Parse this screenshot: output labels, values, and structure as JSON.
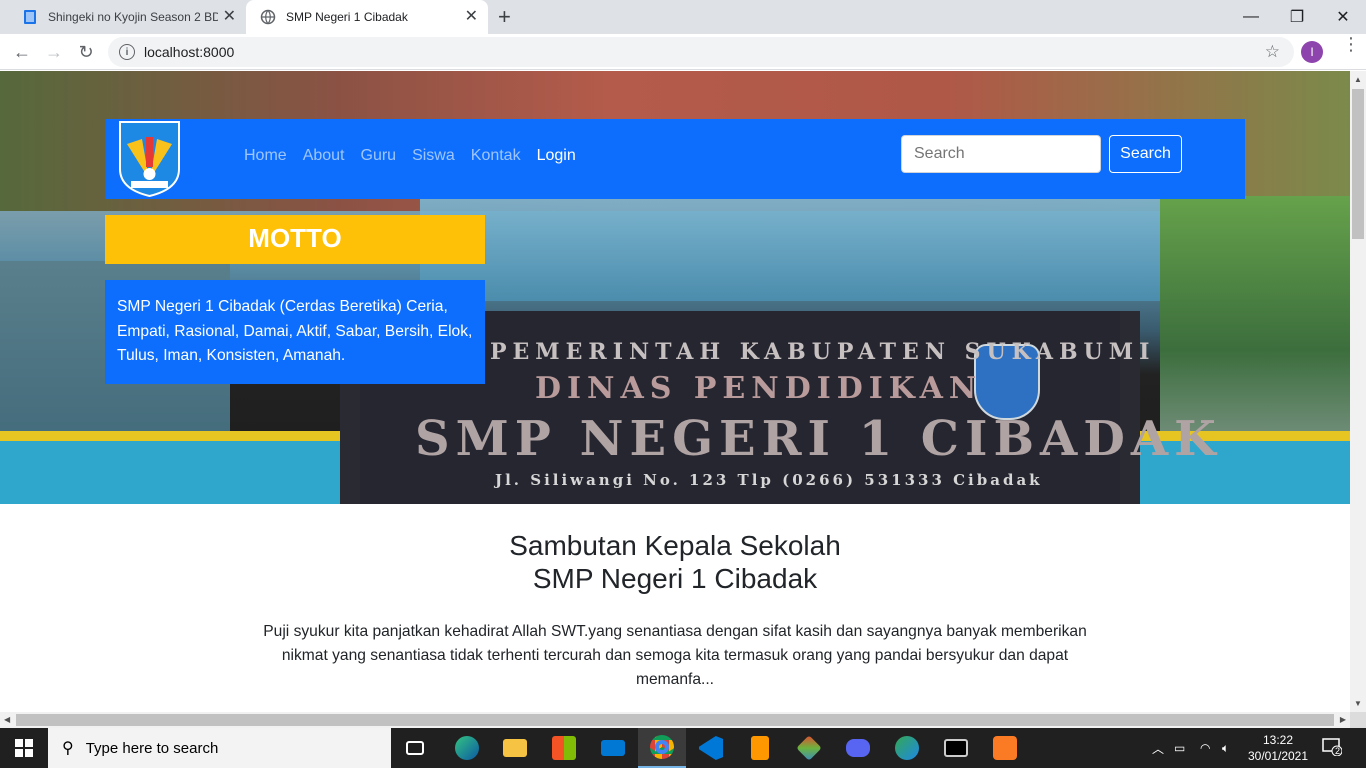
{
  "browser": {
    "tabs": [
      {
        "title": "Shingeki no Kyojin Season 2 BD (",
        "active": false
      },
      {
        "title": "SMP Negeri 1 Cibadak",
        "active": true
      }
    ],
    "url": "localhost:8000",
    "profile_initial": "I"
  },
  "hero": {
    "sign_line1": "PEMERINTAH KABUPATEN SUKABUMI",
    "sign_line2": "DINAS PENDIDIKAN",
    "sign_line3": "SMP NEGERI 1 CIBADAK",
    "sign_line4": "Jl. Siliwangi No. 123 Tlp (0266) 531333 Cibadak"
  },
  "navbar": {
    "links": [
      {
        "label": "Home",
        "active": false
      },
      {
        "label": "About",
        "active": false
      },
      {
        "label": "Guru",
        "active": false
      },
      {
        "label": "Siswa",
        "active": false
      },
      {
        "label": "Kontak",
        "active": false
      },
      {
        "label": "Login",
        "active": true
      }
    ],
    "search_placeholder": "Search",
    "search_button": "Search"
  },
  "motto": {
    "title": "MOTTO",
    "text": "SMP Negeri 1 Cibadak (Cerdas Beretika) Ceria, Empati, Rasional, Damai, Aktif, Sabar, Bersih, Elok, Tulus, Iman, Konsisten, Amanah."
  },
  "welcome": {
    "title_line1": "Sambutan Kepala Sekolah",
    "title_line2": "SMP Negeri 1 Cibadak",
    "text": "Puji syukur kita panjatkan kehadirat Allah SWT.yang senantiasa dengan sifat kasih dan sayangnya banyak memberikan nikmat yang senantiasa tidak terhenti tercurah dan semoga kita termasuk orang yang pandai bersyukur dan dapat memanfa..."
  },
  "taskbar": {
    "search_placeholder": "Type here to search",
    "time": "13:22",
    "date": "30/01/2021",
    "notification_count": "2",
    "pinned_icons": [
      "task-view-icon",
      "edge-icon",
      "file-explorer-icon",
      "store-icon",
      "mail-icon",
      "chrome-icon",
      "vscode-icon",
      "sublime-text-icon",
      "git-icon",
      "discord-icon",
      "browser-icon",
      "terminal-icon",
      "xampp-icon"
    ]
  },
  "colors": {
    "primary": "#0d6efd",
    "warning": "#ffc107",
    "taskbar": "#202020"
  }
}
